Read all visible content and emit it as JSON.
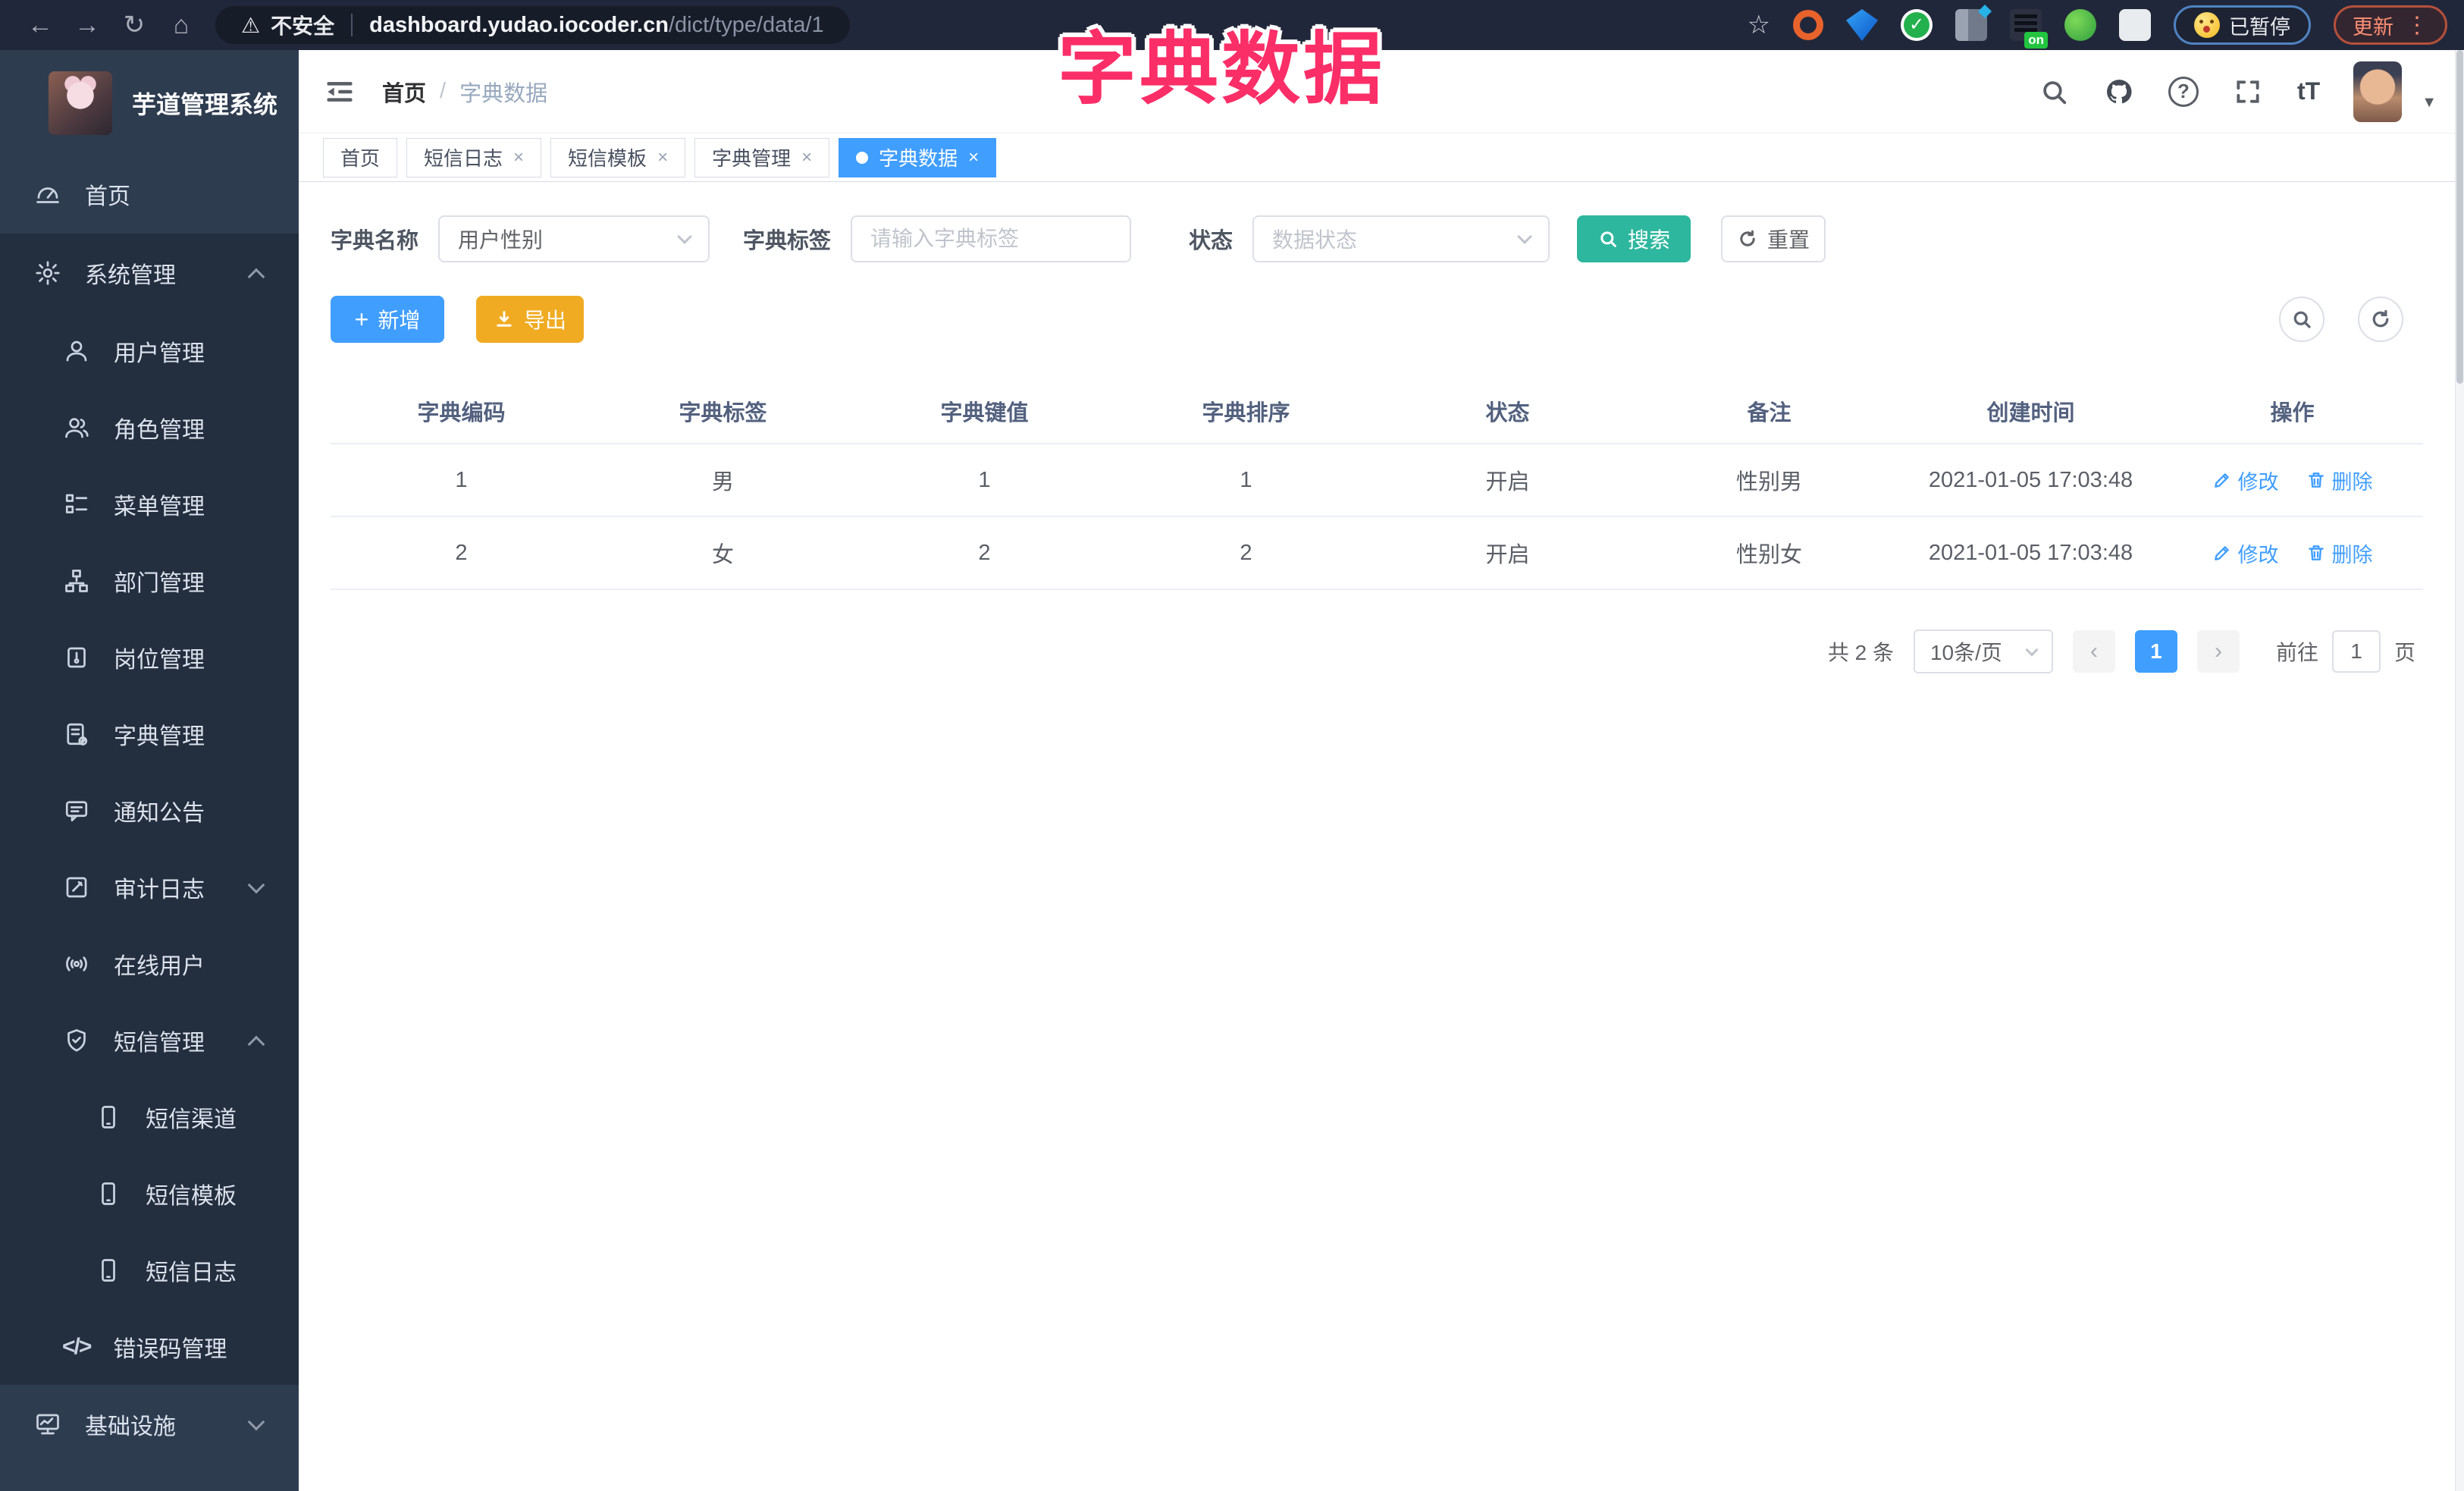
{
  "overlay": {
    "title": "字典数据",
    "color": "#fb2e68"
  },
  "browser": {
    "back_icon": "←",
    "forward_icon": "→",
    "reload_icon": "↻",
    "home_icon": "⌂",
    "warning_icon": "⚠",
    "security_label": "不安全",
    "url_host": "dashboard.yudao.iocoder.cn",
    "url_path": "/dict/type/data/1",
    "star_icon": "☆",
    "paused_label": "已暂停",
    "update_label": "更新",
    "kebab_icon": "⋮"
  },
  "sidebar": {
    "app_title": "芋道管理系统",
    "items": [
      {
        "label": "首页"
      },
      {
        "label": "系统管理"
      },
      {
        "label": "用户管理"
      },
      {
        "label": "角色管理"
      },
      {
        "label": "菜单管理"
      },
      {
        "label": "部门管理"
      },
      {
        "label": "岗位管理"
      },
      {
        "label": "字典管理"
      },
      {
        "label": "通知公告"
      },
      {
        "label": "审计日志"
      },
      {
        "label": "在线用户"
      },
      {
        "label": "短信管理"
      },
      {
        "label": "短信渠道"
      },
      {
        "label": "短信模板"
      },
      {
        "label": "短信日志"
      },
      {
        "label": "错误码管理"
      },
      {
        "label": "基础设施"
      }
    ],
    "code_icon": "</>"
  },
  "navbar": {
    "breadcrumb_home": "首页",
    "breadcrumb_sep": "/",
    "breadcrumb_current": "字典数据",
    "help_icon": "?",
    "font_icon": "tT",
    "caret_icon": "▼"
  },
  "tabs": {
    "close_icon": "×",
    "items": [
      {
        "label": "首页"
      },
      {
        "label": "短信日志"
      },
      {
        "label": "短信模板"
      },
      {
        "label": "字典管理"
      },
      {
        "label": "字典数据"
      }
    ]
  },
  "filters": {
    "name_label": "字典名称",
    "name_value": "用户性别",
    "tag_label": "字典标签",
    "tag_placeholder": "请输入字典标签",
    "status_label": "状态",
    "status_placeholder": "数据状态",
    "search_label": "搜索",
    "reset_label": "重置"
  },
  "toolbar": {
    "plus_icon": "+",
    "add_label": "新增",
    "export_label": "导出"
  },
  "table": {
    "headers": [
      "字典编码",
      "字典标签",
      "字典键值",
      "字典排序",
      "状态",
      "备注",
      "创建时间",
      "操作"
    ],
    "rows": [
      {
        "code": "1",
        "label": "男",
        "value": "1",
        "sort": "1",
        "status": "开启",
        "remark": "性别男",
        "created": "2021-01-05 17:03:48"
      },
      {
        "code": "2",
        "label": "女",
        "value": "2",
        "sort": "2",
        "status": "开启",
        "remark": "性别女",
        "created": "2021-01-05 17:03:48"
      }
    ],
    "edit_label": "修改",
    "delete_label": "删除"
  },
  "pagination": {
    "total_label": "共 2 条",
    "page_size": "10条/页",
    "prev_icon": "‹",
    "next_icon": "›",
    "current_page": "1",
    "goto_label": "前往",
    "goto_value": "1",
    "page_unit": "页"
  }
}
